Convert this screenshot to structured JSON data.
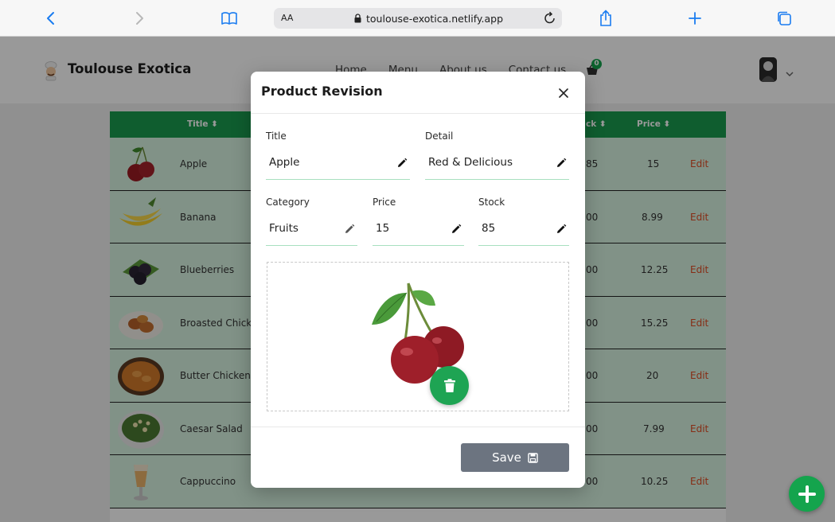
{
  "browser": {
    "aa_label": "AA",
    "url": "toulouse-exotica.netlify.app"
  },
  "header": {
    "brand": "Toulouse Exotica",
    "nav": [
      "Home",
      "Menu",
      "About us",
      "Contact us"
    ],
    "cart_count": "0"
  },
  "table": {
    "headers": {
      "title": "Title ⬍",
      "stock": "ck ⬍",
      "price": "Price ⬍"
    },
    "rows": [
      {
        "title": "Apple",
        "stock": "85",
        "price": "15",
        "action": "Edit"
      },
      {
        "title": "Banana",
        "stock": "00",
        "price": "8.99",
        "action": "Edit"
      },
      {
        "title": "Blueberries",
        "stock": "00",
        "price": "12.25",
        "action": "Edit"
      },
      {
        "title": "Broasted Chicke",
        "stock": "00",
        "price": "15.25",
        "action": "Edit"
      },
      {
        "title": "Butter Chicken",
        "stock": "00",
        "price": "20",
        "action": "Edit"
      },
      {
        "title": "Caesar Salad",
        "stock": "00",
        "price": "7.99",
        "action": "Edit"
      },
      {
        "title": "Cappuccino",
        "stock": "00",
        "price": "10.25",
        "action": "Edit"
      }
    ]
  },
  "modal": {
    "title": "Product Revision",
    "fields": {
      "title": {
        "label": "Title",
        "value": "Apple"
      },
      "detail": {
        "label": "Detail",
        "value": "Red & Delicious"
      },
      "category": {
        "label": "Category",
        "value": "Fruits"
      },
      "price": {
        "label": "Price",
        "value": "15"
      },
      "stock": {
        "label": "Stock",
        "value": "85"
      }
    },
    "save_label": "Save"
  },
  "colors": {
    "accent_green": "#1a9c4f",
    "row_bg": "#d8f3e2",
    "edit_red": "#e04c24",
    "save_gray": "#6c7480"
  }
}
